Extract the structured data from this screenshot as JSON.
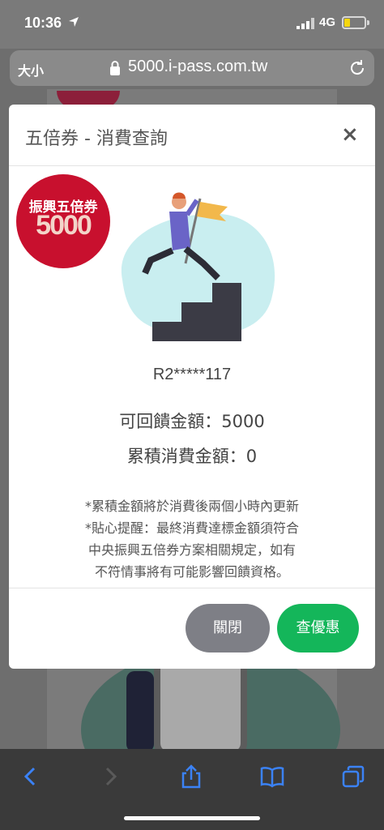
{
  "status_bar": {
    "time": "10:36",
    "network": "4G"
  },
  "browser": {
    "text_size_label": "大小",
    "url": "5000.i-pass.com.tw"
  },
  "modal": {
    "title": "五倍券 - 消費查詢",
    "close_symbol": "×",
    "logo_text": "振興五倍券",
    "logo_number": "5000",
    "card_code": "R2*****117",
    "refund_amount": "可回饋金額：5000",
    "accumulated_spend": "累積消費金額：0",
    "notes": [
      "*累積金額將於消費後兩個小時內更新",
      "*貼心提醒：最終消費達標金額須符合",
      "中央振興五倍券方案相關規定，如有",
      "不符情事將有可能影響回饋資格。"
    ],
    "close_button": "關閉",
    "offers_button": "查優惠"
  },
  "colors": {
    "logo_red": "#c8102e",
    "offers_green": "#14b65a",
    "close_gray": "#7e7f86",
    "toolbar_blue": "#3b82f6"
  },
  "icons": [
    "location-arrow-icon",
    "signal-icon",
    "battery-icon",
    "lock-icon",
    "reload-icon",
    "back-icon",
    "forward-icon",
    "share-icon",
    "bookmarks-icon",
    "tabs-icon"
  ]
}
